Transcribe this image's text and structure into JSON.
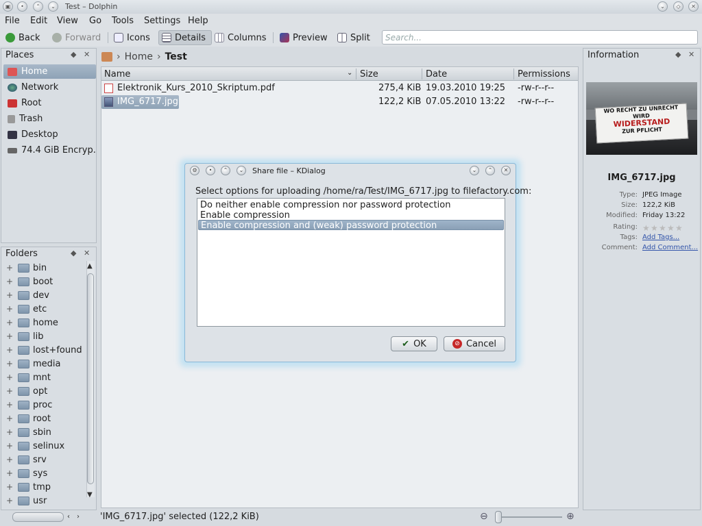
{
  "window": {
    "title": "Test – Dolphin"
  },
  "menubar": {
    "items": [
      "File",
      "Edit",
      "View",
      "Go",
      "Tools",
      "Settings",
      "Help"
    ]
  },
  "toolbar": {
    "back": "Back",
    "forward": "Forward",
    "icons": "Icons",
    "details": "Details",
    "columns": "Columns",
    "preview": "Preview",
    "split": "Split",
    "search_placeholder": "Search..."
  },
  "places": {
    "title": "Places",
    "items": [
      "Home",
      "Network",
      "Root",
      "Trash",
      "Desktop",
      "74.4 GiB Encryp..."
    ]
  },
  "folders": {
    "title": "Folders",
    "items": [
      "bin",
      "boot",
      "dev",
      "etc",
      "home",
      "lib",
      "lost+found",
      "media",
      "mnt",
      "opt",
      "proc",
      "root",
      "sbin",
      "selinux",
      "srv",
      "sys",
      "tmp",
      "usr"
    ]
  },
  "breadcrumb": {
    "home": "Home",
    "current": "Test"
  },
  "fileview": {
    "columns": {
      "name": "Name",
      "size": "Size",
      "date": "Date",
      "permissions": "Permissions"
    },
    "rows": [
      {
        "name": "Elektronik_Kurs_2010_Skriptum.pdf",
        "size": "275,4 KiB",
        "date": "19.03.2010 19:25",
        "permissions": "-rw-r--r--"
      },
      {
        "name": "IMG_6717.jpg",
        "size": "122,2 KiB",
        "date": "07.05.2010 13:22",
        "permissions": "-rw-r--r--"
      }
    ]
  },
  "statusbar": {
    "text": "'IMG_6717.jpg' selected (122,2 KiB)"
  },
  "info": {
    "title": "Information",
    "filename": "IMG_6717.jpg",
    "type_label": "Type:",
    "type": "JPEG Image",
    "size_label": "Size:",
    "size": "122,2 KiB",
    "modified_label": "Modified:",
    "modified": "Friday 13:22",
    "rating_label": "Rating:",
    "tags_label": "Tags:",
    "tags": "Add Tags...",
    "comment_label": "Comment:",
    "comment": "Add Comment...",
    "preview_text": [
      "WO RECHT ZU UNRECHT",
      "WIRD",
      "WIDERSTAND",
      "ZUR PFLICHT"
    ]
  },
  "dialog": {
    "title": "Share file – KDialog",
    "prompt": "Select options for uploading /home/ra/Test/IMG_6717.jpg to filefactory.com:",
    "options": [
      "Do neither enable compression nor password protection",
      "Enable compression",
      "Enable compression and (weak) password protection"
    ],
    "ok": "OK",
    "cancel": "Cancel"
  }
}
